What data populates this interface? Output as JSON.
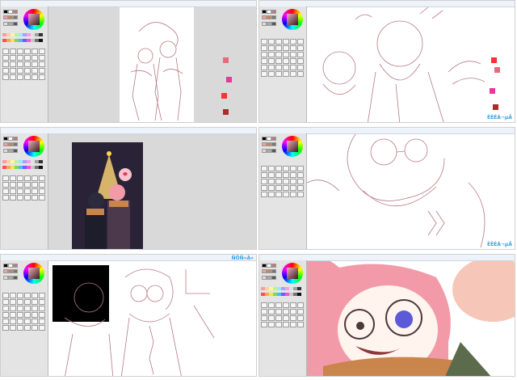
{
  "branding": {
    "panel1": "",
    "panel2": "ÈÈÉ­Á¬µÄ",
    "panel3": "",
    "panel4": "ÈÈÉ­Á¬µÄ",
    "panel5": "Ñ­Ô­Ñ»À»",
    "panel6": ""
  },
  "panels": [
    {
      "label": "Sketch on white page, gray canvas"
    },
    {
      "label": "Close-up line sketch of two characters"
    },
    {
      "label": "Finished colored illustration thumbnail"
    },
    {
      "label": "Close-up glasses character line art"
    },
    {
      "label": "Two characters line art with scarves"
    },
    {
      "label": "Colored pink-haired character close-up"
    }
  ],
  "colors": {
    "sketch": "#b77a86",
    "panel_bg": "#ffffff",
    "tool_bg": "#e4e4e4",
    "canvas_gray": "#d9d9d9",
    "brand_text": "#3aa0e0",
    "hair_pink": "#f29aa8",
    "scarf_orange": "#c9854b",
    "eye_blue": "#5b5ad8",
    "dark_scene": "#2a2236"
  },
  "icons": [
    "color-wheel-icon",
    "brush-tool-icon",
    "layer-icon",
    "palette-icon"
  ]
}
